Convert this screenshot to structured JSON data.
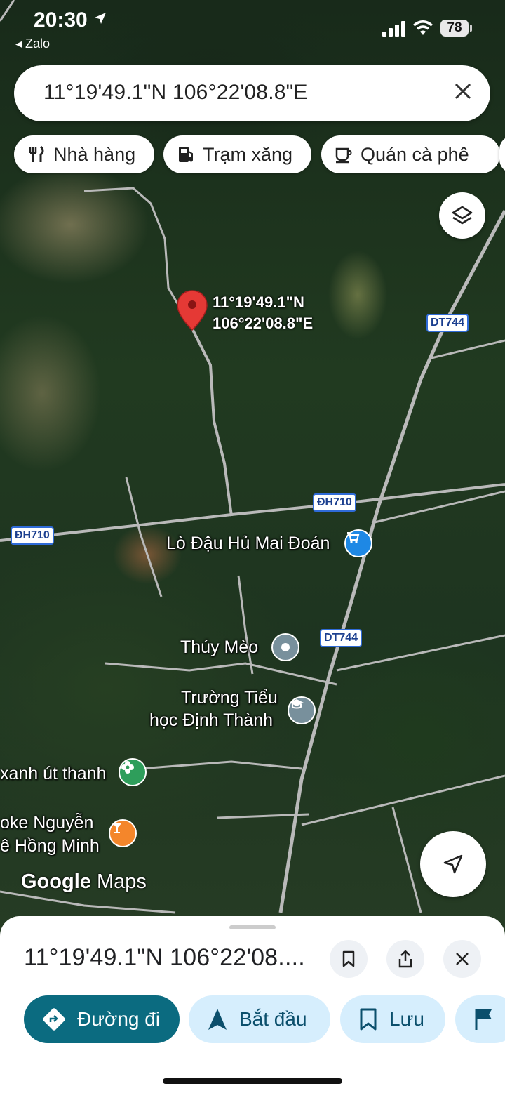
{
  "status_bar": {
    "time": "20:30",
    "back_app": "◂ Zalo",
    "battery": "78"
  },
  "search": {
    "query": "11°19'49.1\"N 106°22'08.8\"E"
  },
  "chips": [
    {
      "label": "Nhà hàng",
      "icon": "restaurant-icon"
    },
    {
      "label": "Trạm xăng",
      "icon": "gas-station-icon"
    },
    {
      "label": "Quán cà phê",
      "icon": "coffee-icon"
    }
  ],
  "map": {
    "pin_label_line1": "11°19'49.1\"N",
    "pin_label_line2": "106°22'08.8\"E",
    "road_shields": {
      "dt744_a": "DT744",
      "dh710_a": "ĐH710",
      "dh710_b": "ĐH710",
      "dt744_b": "DT744"
    },
    "places": {
      "tofu": "Lò Đậu Hủ Mai Đoán",
      "thuy_meo": "Thúy Mèo",
      "school_line1": "Trường Tiểu",
      "school_line2": "học Định Thành",
      "xanh": "xanh út thanh",
      "karaoke_line1": "oke Nguyễn",
      "karaoke_line2": "ê Hồng Minh"
    },
    "logo_google": "Google",
    "logo_maps": "Maps",
    "colors": {
      "pin": "#e53935",
      "shop_poi": "#1e88e5",
      "generic_poi": "#78909c",
      "school_poi": "#78909c",
      "park_poi": "#2e9e5b",
      "bar_poi": "#f4862b"
    }
  },
  "sheet": {
    "title": "11°19'49.1\"N 106°22'08....",
    "actions": [
      {
        "label": "Đường đi",
        "icon": "directions-icon"
      },
      {
        "label": "Bắt đầu",
        "icon": "navigation-arrow-icon"
      },
      {
        "label": "Lưu",
        "icon": "bookmark-icon"
      },
      {
        "label": "",
        "icon": "flag-icon"
      }
    ]
  }
}
